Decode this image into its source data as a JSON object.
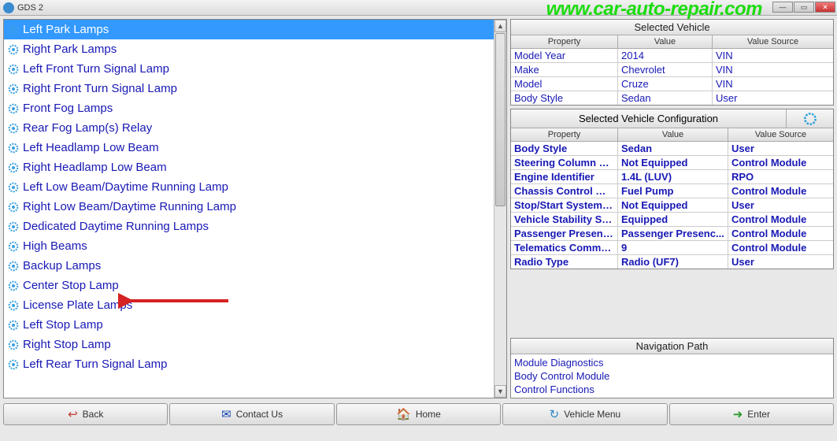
{
  "window": {
    "title": "GDS 2"
  },
  "watermark": "www.car-auto-repair.com",
  "list_items": [
    {
      "label": "Left Park Lamps",
      "selected": true
    },
    {
      "label": "Right Park Lamps"
    },
    {
      "label": "Left Front Turn Signal Lamp"
    },
    {
      "label": "Right Front Turn Signal Lamp"
    },
    {
      "label": "Front Fog Lamps"
    },
    {
      "label": "Rear Fog Lamp(s) Relay"
    },
    {
      "label": "Left Headlamp Low Beam"
    },
    {
      "label": "Right Headlamp Low Beam"
    },
    {
      "label": "Left Low Beam/Daytime Running Lamp"
    },
    {
      "label": "Right Low Beam/Daytime Running Lamp"
    },
    {
      "label": "Dedicated Daytime Running Lamps"
    },
    {
      "label": "High Beams"
    },
    {
      "label": "Backup Lamps"
    },
    {
      "label": "Center Stop Lamp"
    },
    {
      "label": "License Plate Lamps"
    },
    {
      "label": "Left Stop Lamp"
    },
    {
      "label": "Right Stop Lamp"
    },
    {
      "label": "Left Rear Turn Signal Lamp"
    }
  ],
  "selected_vehicle": {
    "title": "Selected Vehicle",
    "headers": {
      "property": "Property",
      "value": "Value",
      "source": "Value Source"
    },
    "rows": [
      {
        "property": "Model Year",
        "value": "2014",
        "source": "VIN"
      },
      {
        "property": "Make",
        "value": "Chevrolet",
        "source": "VIN"
      },
      {
        "property": "Model",
        "value": "Cruze",
        "source": "VIN"
      },
      {
        "property": "Body Style",
        "value": "Sedan",
        "source": "User"
      }
    ]
  },
  "vehicle_config": {
    "title": "Selected Vehicle Configuration",
    "headers": {
      "property": "Property",
      "value": "Value",
      "source": "Value Source"
    },
    "rows": [
      {
        "property": "Body Style",
        "value": "Sedan",
        "source": "User"
      },
      {
        "property": "Steering Column Lo...",
        "value": "Not Equipped",
        "source": "Control Module"
      },
      {
        "property": "Engine Identifier",
        "value": "1.4L (LUV)",
        "source": "RPO"
      },
      {
        "property": "Chassis Control Mo...",
        "value": "Fuel Pump",
        "source": "Control Module"
      },
      {
        "property": "Stop/Start System (K...",
        "value": "Not Equipped",
        "source": "User"
      },
      {
        "property": "Vehicle Stability Sys...",
        "value": "Equipped",
        "source": "Control Module"
      },
      {
        "property": "Passenger Presence...",
        "value": "Passenger Presenc...",
        "source": "Control Module"
      },
      {
        "property": "Telematics Commun...",
        "value": "9",
        "source": "Control Module"
      },
      {
        "property": "Radio Type",
        "value": "Radio (UF7)",
        "source": "User"
      }
    ]
  },
  "navigation": {
    "title": "Navigation Path",
    "items": [
      "Module Diagnostics",
      "Body Control Module",
      "Control Functions"
    ]
  },
  "footer": {
    "back": "Back",
    "contact": "Contact Us",
    "home": "Home",
    "vehicle_menu": "Vehicle Menu",
    "enter": "Enter"
  }
}
